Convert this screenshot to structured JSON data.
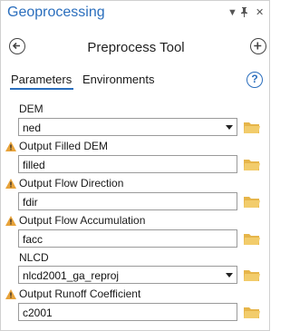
{
  "window": {
    "title": "Geoprocessing"
  },
  "header": {
    "tool_title": "Preprocess Tool"
  },
  "tabs": [
    {
      "label": "Parameters",
      "active": true
    },
    {
      "label": "Environments",
      "active": false
    }
  ],
  "params": [
    {
      "label": "DEM",
      "value": "ned",
      "type": "dropdown",
      "warning": false
    },
    {
      "label": "Output Filled DEM",
      "value": "filled",
      "type": "text",
      "warning": true
    },
    {
      "label": "Output Flow Direction",
      "value": "fdir",
      "type": "text",
      "warning": true
    },
    {
      "label": "Output Flow Accumulation",
      "value": "facc",
      "type": "text",
      "warning": true
    },
    {
      "label": "NLCD",
      "value": "nlcd2001_ga_reproj",
      "type": "dropdown",
      "warning": false
    },
    {
      "label": "Output Runoff Coefficient",
      "value": "c2001",
      "type": "text",
      "warning": true
    }
  ],
  "colors": {
    "accent": "#2a6ebd",
    "warning": "#e8a33a",
    "folder": "#e6b54a"
  }
}
